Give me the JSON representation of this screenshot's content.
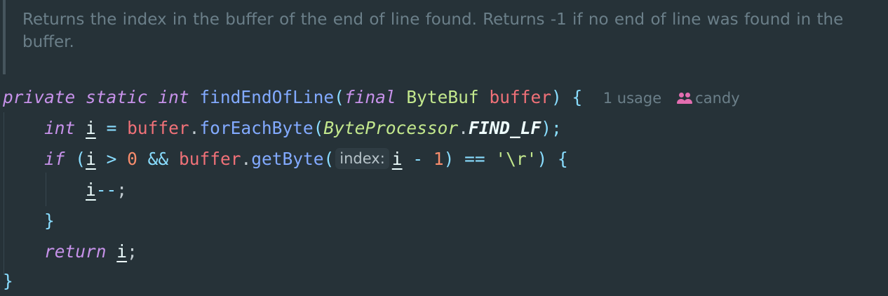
{
  "doc_comment": {
    "text": "Returns the index in the buffer of the end of line found. Returns -1 if no end of line was found in the buffer."
  },
  "code": {
    "signature": {
      "kw_private": "private",
      "kw_static": "static",
      "kw_int": "int",
      "method_name": "findEndOfLine",
      "open_paren": "(",
      "kw_final": "final",
      "param_type": "ByteBuf",
      "param_name": "buffer",
      "close_paren": ")",
      "open_brace": "{"
    },
    "codelens": {
      "usages": "1 usage",
      "author": "candy",
      "author_icon": "users-icon"
    },
    "line1": {
      "kw_int": "int",
      "var": "i",
      "assign": "=",
      "receiver": "buffer",
      "dot": ".",
      "method": "forEachByte",
      "open_paren": "(",
      "class_name": "ByteProcessor",
      "dot2": ".",
      "constant": "FIND_LF",
      "close": ");"
    },
    "line2": {
      "kw_if": "if",
      "open_paren": "(",
      "var": "i",
      "gt": ">",
      "zero": "0",
      "and": "&&",
      "receiver": "buffer",
      "dot": ".",
      "method": "getByte",
      "open_paren2": "(",
      "param_hint": "index:",
      "var2": "i",
      "minus": "-",
      "one": "1",
      "close_paren": ")",
      "eq": "==",
      "char_literal": "'\\r'",
      "close_paren2": ")",
      "open_brace": "{"
    },
    "line3": {
      "var": "i",
      "decrement": "--",
      "semicolon": ";"
    },
    "line4": {
      "close_brace": "}"
    },
    "line5": {
      "kw_return": "return",
      "var": "i",
      "semicolon": ";"
    },
    "line6": {
      "close_brace": "}"
    }
  },
  "colors": {
    "background": "#263238",
    "keyword": "#c792ea",
    "function": "#82aaff",
    "type": "#c3e88d",
    "parameter": "#f07178",
    "number": "#f78c6c",
    "operator": "#89ddff",
    "comment": "#6b7f89",
    "author_icon": "#e36db0"
  }
}
